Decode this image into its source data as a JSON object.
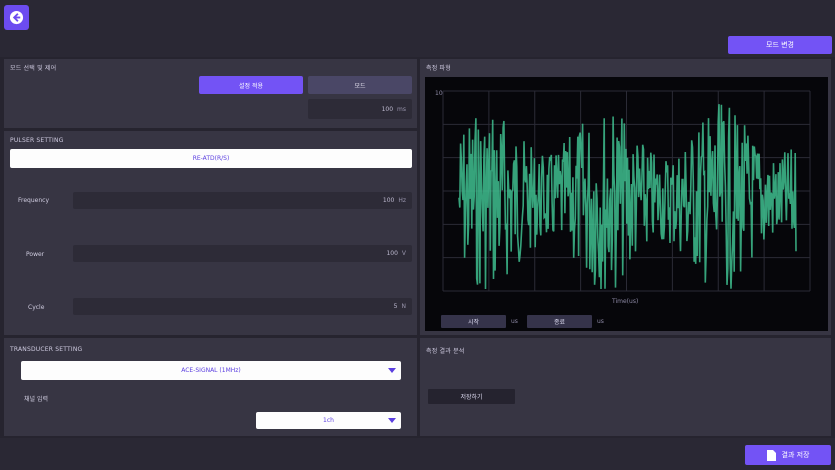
{
  "header": {
    "back_icon": "arrow-left-icon",
    "action_label": "모드 변경"
  },
  "mode_panel": {
    "title": "모드 선택 및 제어",
    "primary_label": "설정 적용",
    "secondary_label": "모드",
    "value": "100",
    "unit": "ms"
  },
  "pulser": {
    "title": "PULSER SETTING",
    "select_value": "RE-ATD(R/S)",
    "frequency_label": "Frequency",
    "frequency_value": "100",
    "frequency_unit": "Hz",
    "power_label": "Power",
    "power_value": "100",
    "power_unit": "V",
    "cycle_label": "Cycle",
    "cycle_value": "5",
    "cycle_unit": "N"
  },
  "graph": {
    "title": "측정 파형",
    "x_label": "Time(us)",
    "ctrl_left_label": "시작",
    "ctrl_left_text": "us",
    "ctrl_right_label": "종료",
    "ctrl_right_text": "us",
    "wave_color": "#3fbf8f",
    "grid_color": "#2b2b36",
    "y_top_tick": "10"
  },
  "transducer": {
    "title": "TRANSDUCER SETTING",
    "select_value": "ACE-SIGNAL (1MHz)",
    "channel_label": "채널 입력",
    "channel_value": "1ch"
  },
  "result_panel": {
    "title": "측정 결과 분석",
    "button_label": "저장하기"
  },
  "footer": {
    "save_label": "결과 저장",
    "save_icon": "document-icon"
  }
}
